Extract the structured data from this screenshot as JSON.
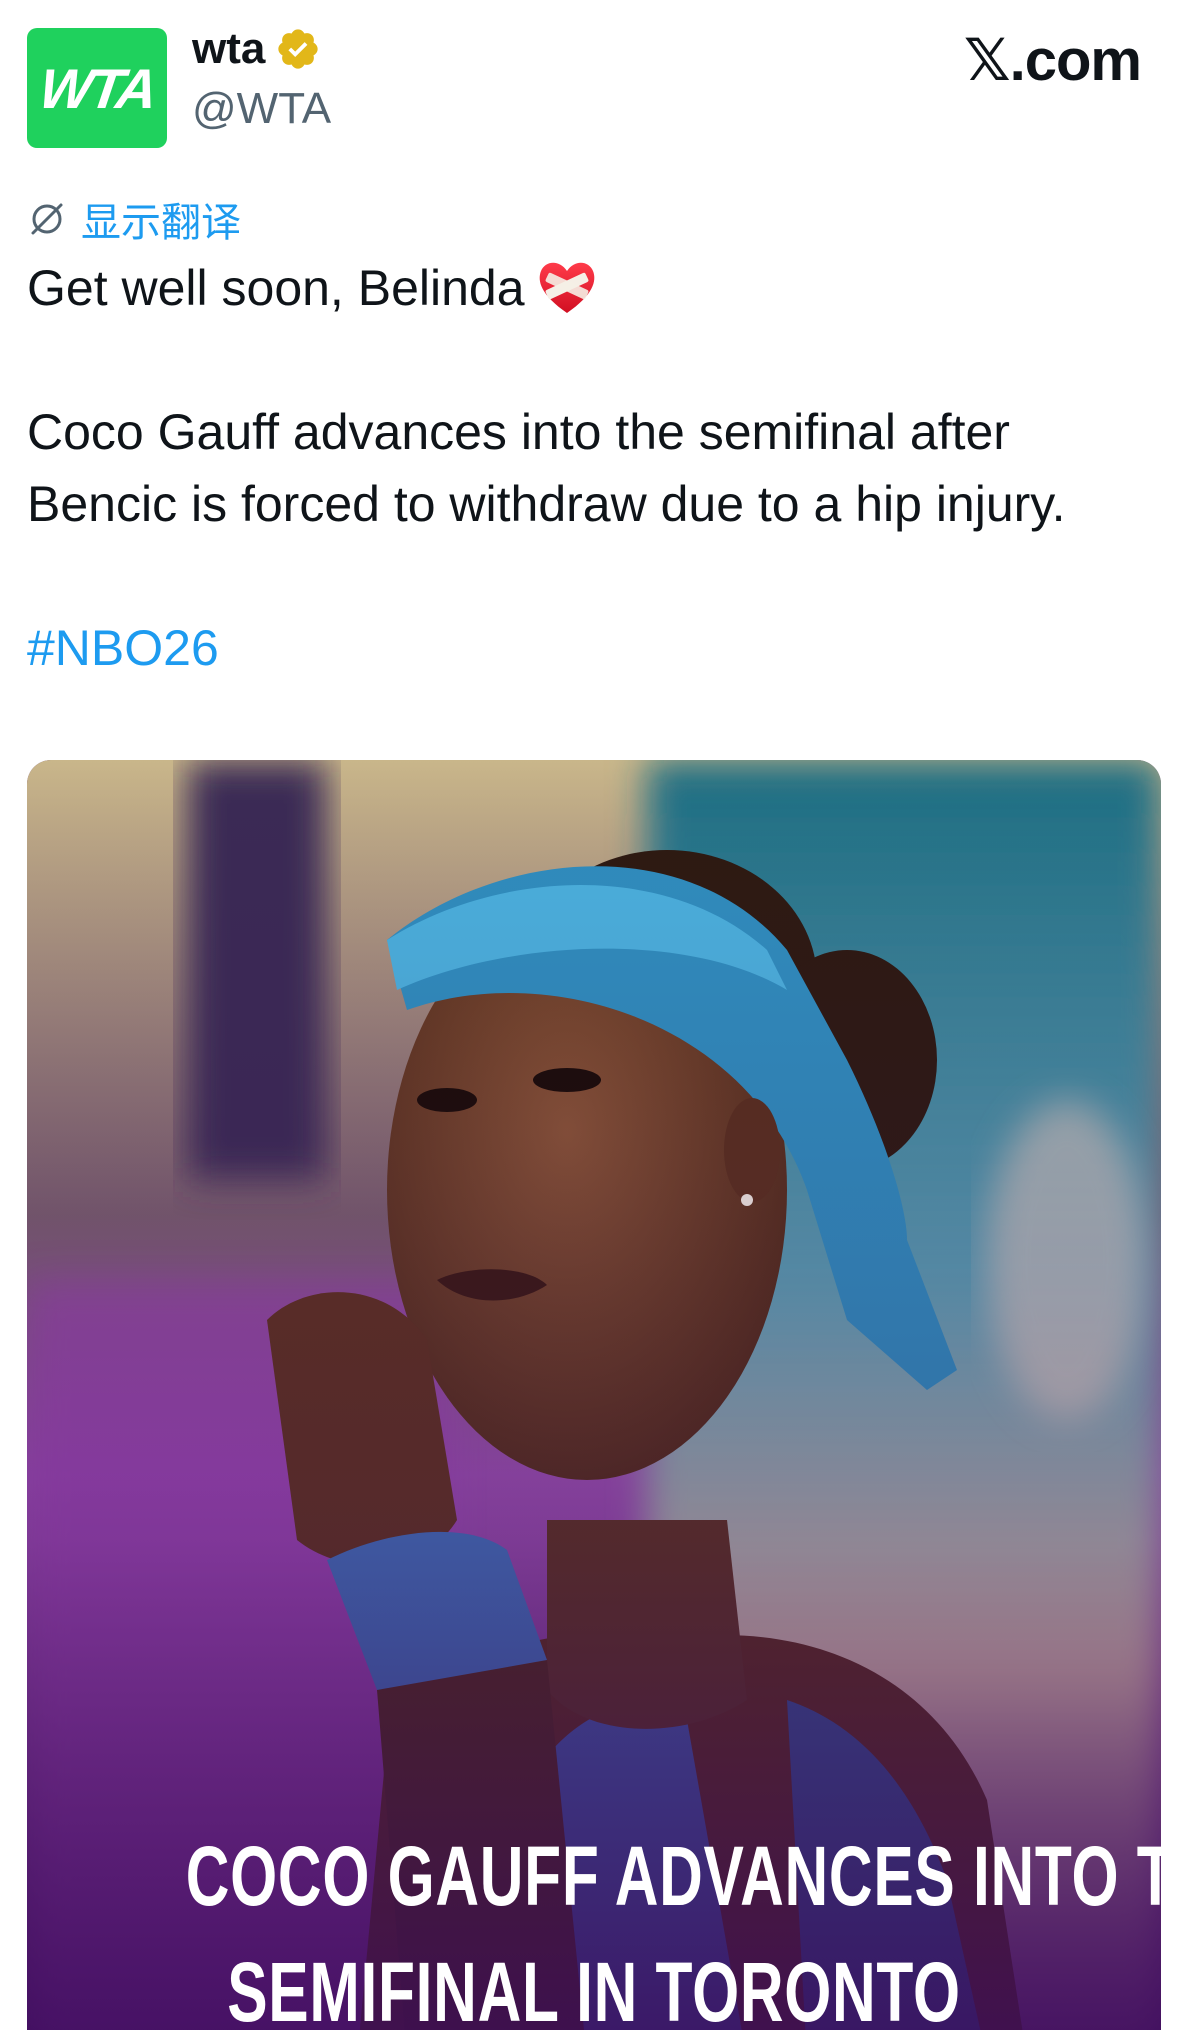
{
  "header": {
    "avatar_text": "WTA",
    "display_name": "wta",
    "handle": "@WTA",
    "site_label": "𝕏.com",
    "verified_icon": "verified-badge-icon",
    "brand_green": "#1fd15d",
    "verified_gold": "#e2b719"
  },
  "translate": {
    "label": "显示翻译",
    "icon": "translate-icon",
    "color": "#1d9bf0"
  },
  "tweet": {
    "line1": "Get well soon, Belinda",
    "line1_emoji": "mending-heart-icon",
    "line2": "Coco Gauff advances into the semifinal after",
    "line3": "Bencic is forced to withdraw due to a hip injury.",
    "hashtag": "#NBO26"
  },
  "media": {
    "caption_line1": "COCO GAUFF ADVANCES INTO THE",
    "caption_line2": "SEMIFINAL IN TORONTO"
  }
}
